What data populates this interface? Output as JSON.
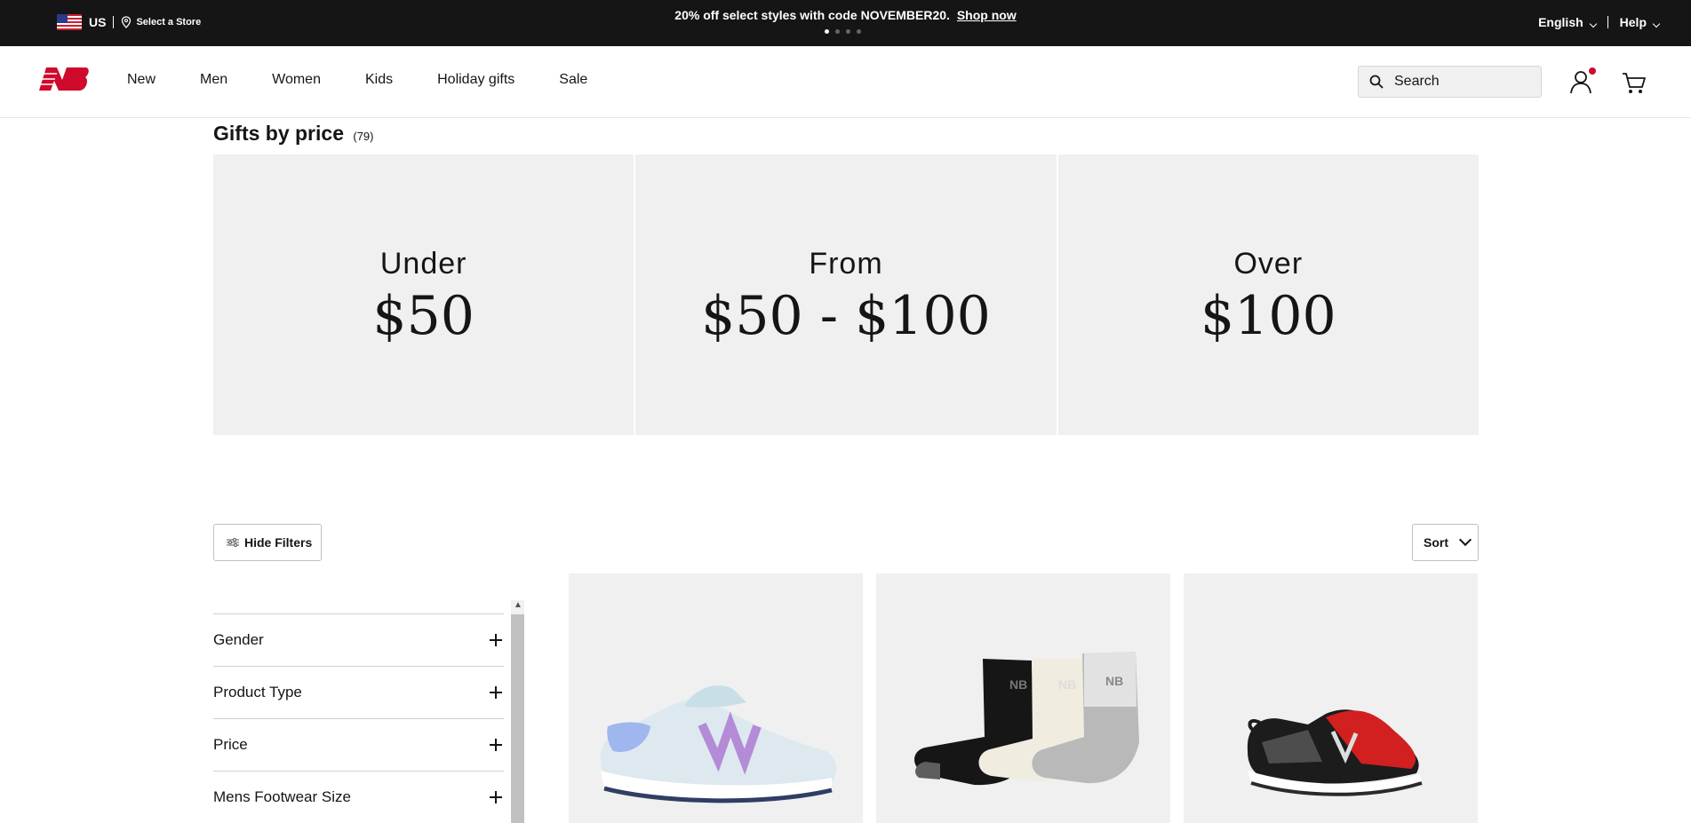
{
  "topbar": {
    "country": "US",
    "store_link": "Select a Store",
    "promo_text": "20% off select styles with code NOVEMBER20.",
    "promo_link": "Shop now",
    "language": "English",
    "help": "Help"
  },
  "header": {
    "logo": "new-balance-logo",
    "nav": [
      "New",
      "Men",
      "Women",
      "Kids",
      "Holiday gifts",
      "Sale"
    ],
    "search_placeholder": "Search"
  },
  "page": {
    "title": "Gifts by price",
    "count": "(79)"
  },
  "price_tiles": [
    {
      "label": "Under",
      "price": "$50"
    },
    {
      "label": "From",
      "price": "$50 - $100"
    },
    {
      "label": "Over",
      "price": "$100"
    }
  ],
  "toolbar": {
    "hide_filters": "Hide Filters",
    "sort": "Sort"
  },
  "filters": [
    "Gender",
    "Product Type",
    "Price",
    "Mens Footwear Size"
  ],
  "products": [
    {
      "image": "kids-light-blue-sneaker"
    },
    {
      "image": "three-pack-ankle-socks"
    },
    {
      "image": "kids-red-black-sneaker"
    }
  ],
  "colors": {
    "brand_red": "#cf0a2c",
    "topbar_bg": "#151515",
    "tile_bg": "#f0f0f0"
  }
}
